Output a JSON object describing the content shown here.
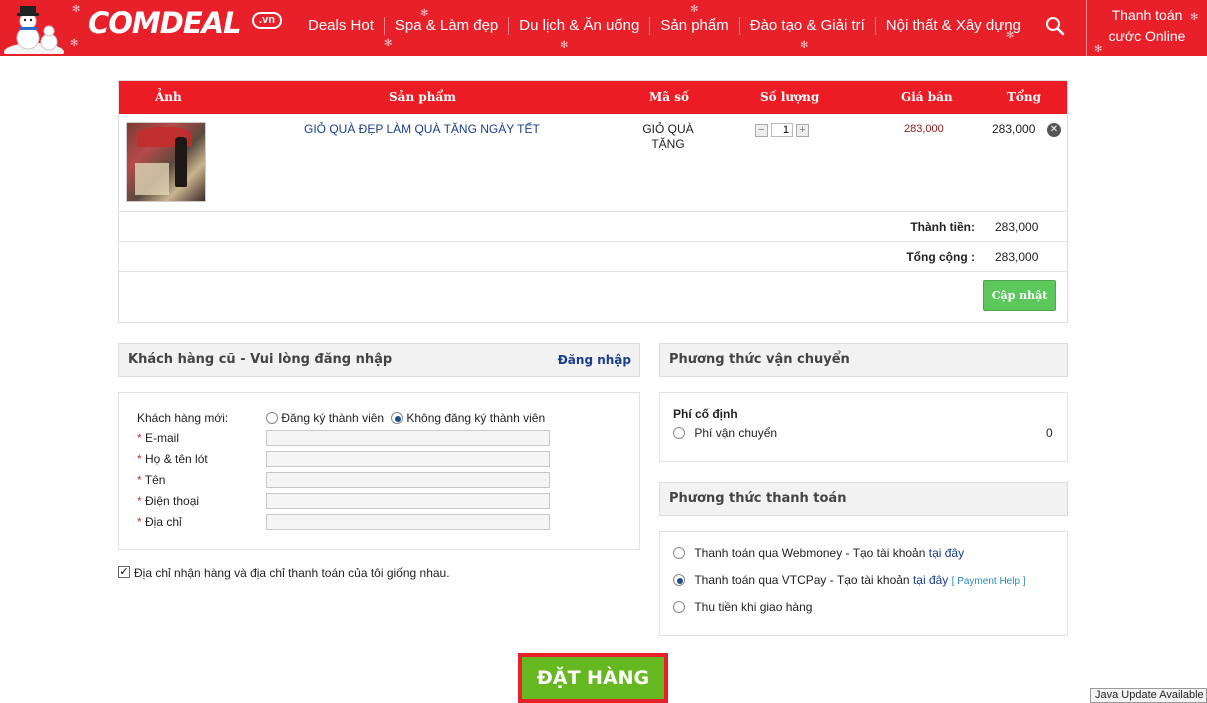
{
  "header": {
    "logo": "COMDEAL",
    "logo_suffix": ".vn",
    "nav": [
      "Deals Hot",
      "Spa & Làm đẹp",
      "Du lịch & Ăn uống",
      "Sản phẩm",
      "Đào tạo & Giải trí",
      "Nội thất & Xây dựng"
    ],
    "pay_line1": "Thanh toán",
    "pay_line2": "cước Online"
  },
  "cart": {
    "columns": {
      "image": "Ảnh",
      "product": "Sản phẩm",
      "code": "Mã số",
      "quantity": "Số lượng",
      "price": "Giá bán",
      "total": "Tổng"
    },
    "item": {
      "name": "GIỎ QUÀ ĐẸP LÀM QUÀ TẶNG NGÀY TẾT",
      "code_line1": "GIỎ QUÀ",
      "code_line2": "TẶNG",
      "quantity": "1",
      "price": "283,000",
      "total": "283,000"
    },
    "subtotal_label": "Thành tiền:",
    "subtotal_value": "283,000",
    "grand_total_label": "Tổng cộng :",
    "grand_total_value": "283,000",
    "update_button": "Cập nhật"
  },
  "login": {
    "title": "Khách hàng cũ - Vui lòng đăng nhập",
    "link": "Đăng nhập"
  },
  "new_customer": {
    "label": "Khách hàng mới:",
    "option_register": "Đăng ký thành viên",
    "option_no_register": "Không đăng ký thành viên",
    "fields": {
      "email": "E-mail",
      "last_name": "Họ & tên lót",
      "first_name": "Tên",
      "phone": "Điện thoại",
      "address": "Địa chỉ"
    },
    "required_mark": "*",
    "same_address": "Địa chỉ nhận hàng và địa chỉ thanh toán của tôi giống nhau."
  },
  "shipping": {
    "title": "Phương thức vận chuyển",
    "fixed_fee_label": "Phí cố định",
    "option": "Phí vận chuyển",
    "fee": "0"
  },
  "payment": {
    "title": "Phương thức thanh toán",
    "webmoney_text": "Thanh toán qua Webmoney - Tạo tài khoản",
    "webmoney_link": "tại đây",
    "vtc_text": "Thanh toán qua VTCPay - Tạo tài khoản",
    "vtc_link": "tại đây",
    "vtc_help": "[ Payment Help ]",
    "cod": "Thu tiền khi giao hàng"
  },
  "order_button": "ĐẶT HÀNG",
  "java_notice": "Java Update Available",
  "colors": {
    "brand_red": "#e8202a",
    "order_green": "#66b821",
    "link_blue": "#1a3e8e"
  }
}
